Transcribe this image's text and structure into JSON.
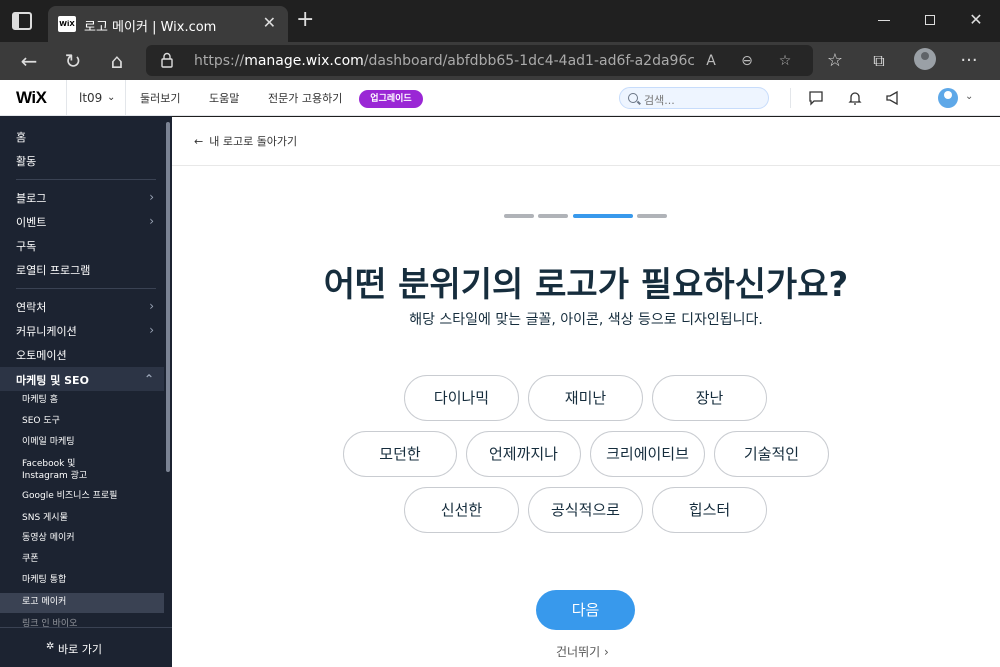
{
  "browser": {
    "tab_title": "로고 메이커 | Wix.com",
    "tab_favicon_text": "WiX",
    "url_host": "manage.wix.com",
    "url_prefix": "https://",
    "url_path": "/dashboard/abfdbb65-1dc4-4ad1-ad6f-a2da96c9b6e0/..."
  },
  "wix_bar": {
    "logo": "WiX",
    "site_name": "lt09",
    "nav": [
      "둘러보기",
      "도움말",
      "전문가 고용하기"
    ],
    "upgrade_label": "업그레이드",
    "search_placeholder": "검색..."
  },
  "sidebar": {
    "items": [
      {
        "label": "홈"
      },
      {
        "label": "활동"
      },
      {
        "label": "블로그"
      },
      {
        "label": "이벤트"
      },
      {
        "label": "구독"
      },
      {
        "label": "로열티 프로그램"
      },
      {
        "label": "연락처"
      },
      {
        "label": "커뮤니케이션"
      },
      {
        "label": "오토메이션"
      },
      {
        "label": "마케팅 및 SEO"
      }
    ],
    "sub_items": [
      {
        "label": "마케팅 홈"
      },
      {
        "label": "SEO 도구"
      },
      {
        "label": "이메일 마케팅"
      },
      {
        "label": "Facebook 및"
      },
      {
        "label": "Instagram 광고"
      },
      {
        "label": "Google 비즈니스 프로필"
      },
      {
        "label": "SNS 게시물"
      },
      {
        "label": "동영상 메이커"
      },
      {
        "label": "쿠폰"
      },
      {
        "label": "마케팅 통합"
      },
      {
        "label": "로고 메이커"
      },
      {
        "label": "링크 인 바이오"
      }
    ],
    "footer_label": "바로 가기"
  },
  "main": {
    "back_label": "내 로고로 돌아가기",
    "progress": {
      "total_steps": 4,
      "current_step": 3
    },
    "headline": "어떤 분위기의 로고가 필요하신가요?",
    "subline": "해당 스타일에 맞는 글꼴, 아이콘, 색상 등으로 디자인됩니다.",
    "chips": [
      "다이나믹",
      "재미난",
      "장난",
      "모던한",
      "언제까지나",
      "크리에이티브",
      "기술적인",
      "신선한",
      "공식적으로",
      "힙스터"
    ],
    "next_label": "다음",
    "skip_label": "건너뛰기 ›"
  },
  "colors": {
    "accent_blue": "#3899ec",
    "upgrade_purple": "#9a27d5",
    "sidebar_bg": "#1c2331",
    "headline": "#162d3d"
  }
}
